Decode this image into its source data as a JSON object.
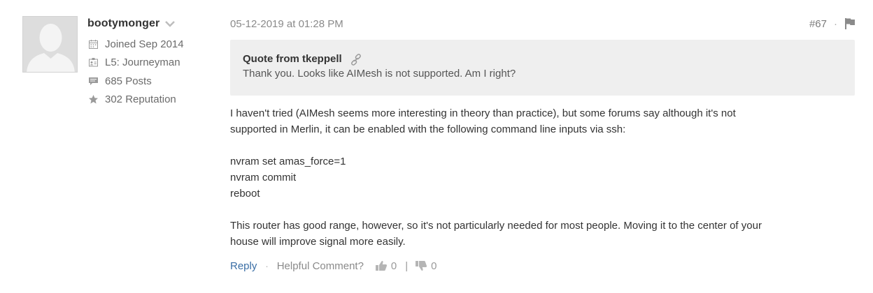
{
  "author": {
    "username": "bootymonger",
    "joined": "Joined Sep 2014",
    "level": "L5: Journeyman",
    "posts": "685 Posts",
    "reputation": "302 Reputation"
  },
  "post": {
    "timestamp": "05-12-2019 at 01:28 PM",
    "number": "#67",
    "quote": {
      "author": "Quote from tkeppell",
      "text": "Thank you. Looks like AIMesh is not supported. Am I right?"
    },
    "body": {
      "p1_line1": "I haven't tried (AIMesh seems more interesting in theory than practice), but some forums say although it's not",
      "p1_line2": "supported in Merlin, it can be enabled with the following command line inputs via ssh:",
      "cmd1": "nvram set amas_force=1",
      "cmd2": "nvram commit",
      "cmd3": "reboot",
      "p3_line1": "This router has good range, however, so it's not particularly needed for most people. Moving it to the center of your",
      "p3_line2": "house will improve signal more easily."
    }
  },
  "actions": {
    "reply": "Reply",
    "helpful": "Helpful Comment?",
    "upvotes": "0",
    "downvotes": "0",
    "separator": "|",
    "dot": "·"
  },
  "colors": {
    "link": "#3a6ea5",
    "muted": "#8a8a8a",
    "quote_bg": "#efefef"
  },
  "icons": [
    "user-avatar-placeholder",
    "chevron-down-icon",
    "calendar-icon",
    "id-card-icon",
    "comment-icon",
    "star-icon",
    "flag-icon",
    "link-icon",
    "thumbs-up-icon",
    "thumbs-down-icon"
  ]
}
